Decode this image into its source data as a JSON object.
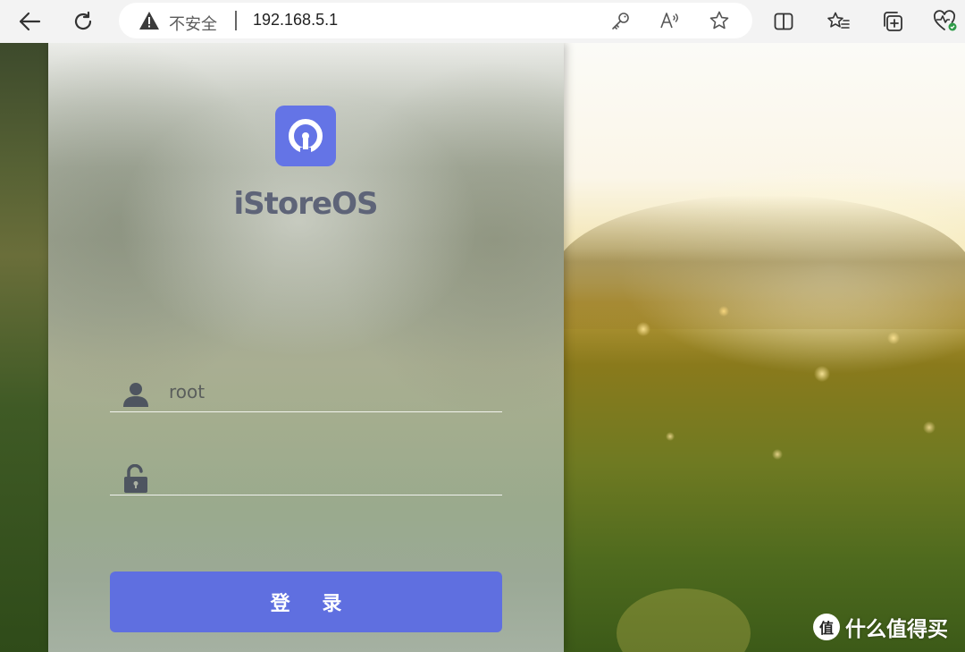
{
  "browser": {
    "security_label": "不安全",
    "url": "192.168.5.1",
    "icons": {
      "back": "back-arrow-icon",
      "refresh": "refresh-icon",
      "warning": "warning-triangle-icon",
      "key": "key-icon",
      "read_aloud": "read-aloud-icon",
      "favorite": "star-icon",
      "split_screen": "split-screen-icon",
      "favorites_bar": "favorites-icon",
      "collections": "collections-icon",
      "browser_essentials": "heart-pulse-icon"
    }
  },
  "login": {
    "brand_name": "iStoreOS",
    "username_value": "root",
    "password_value": "",
    "submit_label": "登 录",
    "accent_color": "#5f6fe0",
    "logo_color": "#6474e6"
  },
  "watermark": {
    "glyph": "值",
    "text": "什么值得买"
  }
}
